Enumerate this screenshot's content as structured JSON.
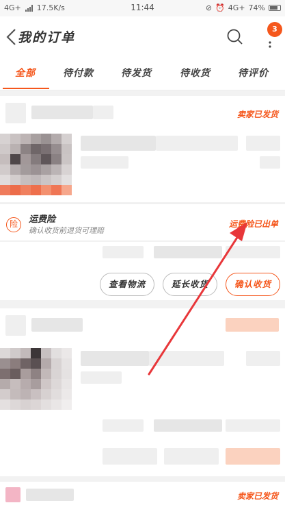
{
  "status_bar": {
    "network_left": "4G+",
    "speed": "17.5K/s",
    "time": "11:44",
    "network_right": "4G+",
    "battery": "74%"
  },
  "nav": {
    "title": "我的订单",
    "badge_count": "3"
  },
  "tabs": [
    {
      "label": "全部",
      "active": true
    },
    {
      "label": "待付款",
      "active": false
    },
    {
      "label": "待发货",
      "active": false
    },
    {
      "label": "待收货",
      "active": false
    },
    {
      "label": "待评价",
      "active": false
    }
  ],
  "orders": [
    {
      "status": "卖家已发货",
      "insurance": {
        "icon": "险",
        "title": "运费险",
        "subtitle": "确认收货前退货可理赔",
        "status": "运费险已出单"
      },
      "actions": [
        "查看物流",
        "延长收货",
        "确认收货"
      ]
    },
    {
      "status": "卖家已发货"
    }
  ],
  "colors": {
    "accent": "#f5571c",
    "annotation_arrow": "#e8373a"
  }
}
